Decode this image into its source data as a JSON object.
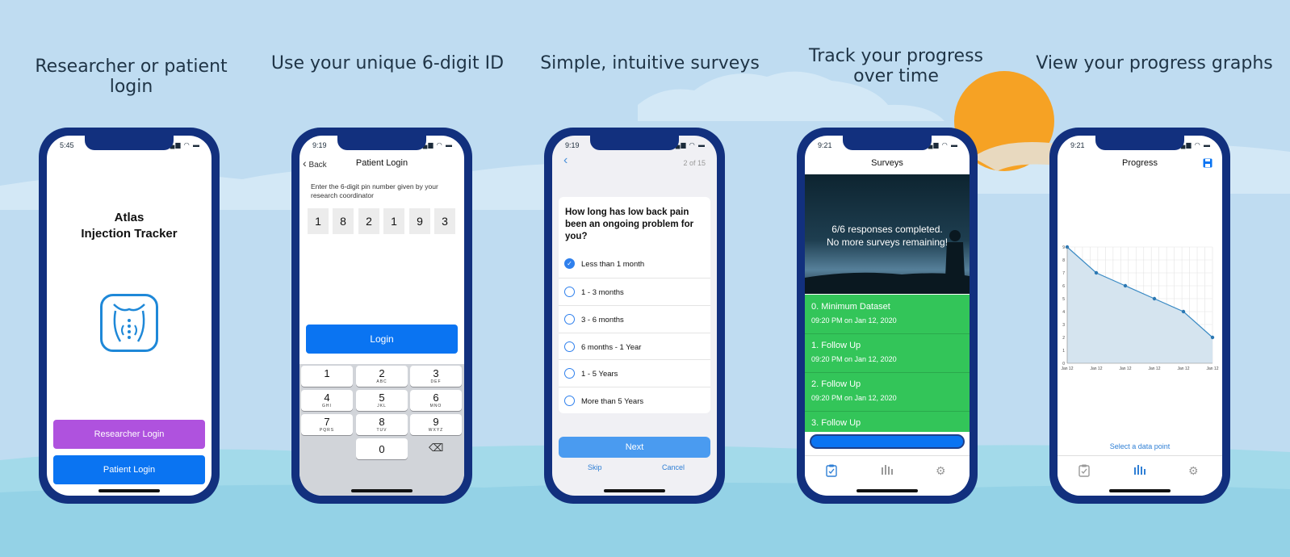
{
  "captions": [
    "Researcher or patient login",
    "Use your unique 6-digit ID",
    "Simple, intuitive surveys",
    "Track your progress over time",
    "View your progress graphs"
  ],
  "colors": {
    "phone_frame": "#12307e",
    "primary_blue": "#0a74f2",
    "purple": "#af52de",
    "green": "#33c559",
    "sun": "#f6a224"
  },
  "phone1": {
    "time": "5:45",
    "app_name_line1": "Atlas",
    "app_name_line2": "Injection Tracker",
    "researcher_login": "Researcher Login",
    "patient_login": "Patient Login"
  },
  "phone2": {
    "time": "9:19",
    "back": "Back",
    "title": "Patient Login",
    "prompt": "Enter the 6-digit pin number given by your research coordinator",
    "pin": [
      "1",
      "8",
      "2",
      "1",
      "9",
      "3"
    ],
    "login": "Login",
    "keys": [
      {
        "n": "1",
        "l": ""
      },
      {
        "n": "2",
        "l": "ABC"
      },
      {
        "n": "3",
        "l": "DEF"
      },
      {
        "n": "4",
        "l": "GHI"
      },
      {
        "n": "5",
        "l": "JKL"
      },
      {
        "n": "6",
        "l": "MNO"
      },
      {
        "n": "7",
        "l": "PQRS"
      },
      {
        "n": "8",
        "l": "TUV"
      },
      {
        "n": "9",
        "l": "WXYZ"
      },
      {
        "n": "0",
        "l": ""
      }
    ],
    "delete_glyph": "⌫"
  },
  "phone3": {
    "time": "9:19",
    "back_glyph": "‹",
    "progress": "2 of 15",
    "question": "How long has low back pain been an ongoing problem for you?",
    "options": [
      "Less than 1 month",
      "1 - 3 months",
      "3 - 6 months",
      "6 months - 1 Year",
      "1 - 5 Years",
      "More than 5 Years"
    ],
    "selected_index": 0,
    "next": "Next",
    "skip": "Skip",
    "cancel": "Cancel"
  },
  "phone4": {
    "time": "9:21",
    "title": "Surveys",
    "hero_line1": "6/6 responses completed.",
    "hero_line2": "No more surveys remaining!",
    "surveys": [
      {
        "title": "0. Minimum Dataset",
        "date": "09:20 PM on Jan 12, 2020"
      },
      {
        "title": "1. Follow Up",
        "date": "09:20 PM on Jan 12, 2020"
      },
      {
        "title": "2. Follow Up",
        "date": "09:20 PM on Jan 12, 2020"
      },
      {
        "title": "3. Follow Up",
        "date": ""
      }
    ],
    "tab_icons": [
      "clipboard-check-icon",
      "bar-chart-icon",
      "gear-icon"
    ]
  },
  "phone5": {
    "time": "9:21",
    "title": "Progress",
    "select_hint": "Select a data point",
    "tab_icons": [
      "clipboard-check-icon",
      "bar-chart-icon",
      "gear-icon"
    ]
  },
  "chart_data": {
    "type": "area",
    "x": [
      "Jan 12",
      "Jan 12",
      "Jan 12",
      "Jan 12",
      "Jan 12",
      "Jan 12"
    ],
    "values": [
      9,
      7,
      6,
      5,
      4,
      2
    ],
    "ylim": [
      0,
      9
    ],
    "yticks": [
      "0",
      "1",
      "2",
      "3",
      "4",
      "5",
      "6",
      "7",
      "8",
      "9"
    ],
    "grid": true,
    "title": "",
    "xlabel": "",
    "ylabel": ""
  }
}
